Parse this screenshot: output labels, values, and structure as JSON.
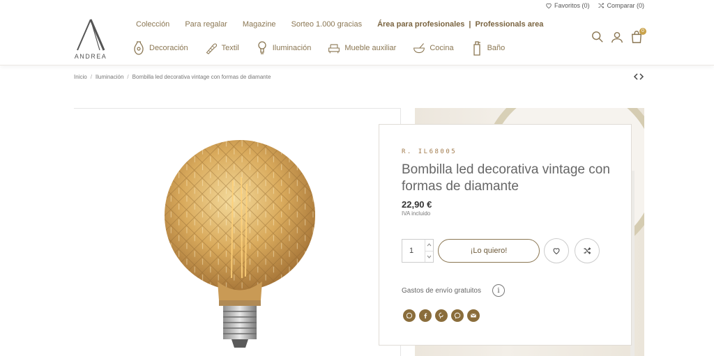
{
  "topbar": {
    "favorites_label": "Favoritos (0)",
    "compare_label": "Comparar (0)"
  },
  "logo": {
    "text": "ANDREA"
  },
  "nav": {
    "primary": [
      {
        "label": "Colección"
      },
      {
        "label": "Para regalar"
      },
      {
        "label": "Magazine"
      },
      {
        "label": "Sorteo 1.000 gracias"
      }
    ],
    "pro_label": "Área para profesionales",
    "pro_separator": "|",
    "pro_label_en": "Professionals area",
    "categories": [
      {
        "label": "Decoración",
        "icon": "vase-icon"
      },
      {
        "label": "Textil",
        "icon": "fabric-roll-icon"
      },
      {
        "label": "Iluminación",
        "icon": "lightbulb-icon"
      },
      {
        "label": "Mueble auxiliar",
        "icon": "armchair-icon"
      },
      {
        "label": "Cocina",
        "icon": "mortar-icon"
      },
      {
        "label": "Baño",
        "icon": "soap-bottle-icon"
      }
    ],
    "cart_count": "0"
  },
  "breadcrumb": {
    "items": [
      "Inicio",
      "Iluminación",
      "Bombilla led decorativa vintage con formas de diamante"
    ],
    "separator": "/"
  },
  "product": {
    "reference": "R. IL68005",
    "title": "Bombilla led decorativa vintage con formas de diamante",
    "price": "22,90 €",
    "vat_note": "IVA incluido",
    "quantity": "1",
    "buy_label": "¡Lo quiero!",
    "shipping_text": "Gastos de envío gratuitos",
    "info_glyph": "i"
  },
  "share": [
    "whatsapp-icon",
    "facebook-icon",
    "pinterest-icon",
    "messenger-icon",
    "email-icon"
  ],
  "colors": {
    "accent": "#8a7652",
    "accent_dark": "#6d5a3a",
    "badge": "#c9a24a",
    "share_bg": "#8a6d3b"
  }
}
